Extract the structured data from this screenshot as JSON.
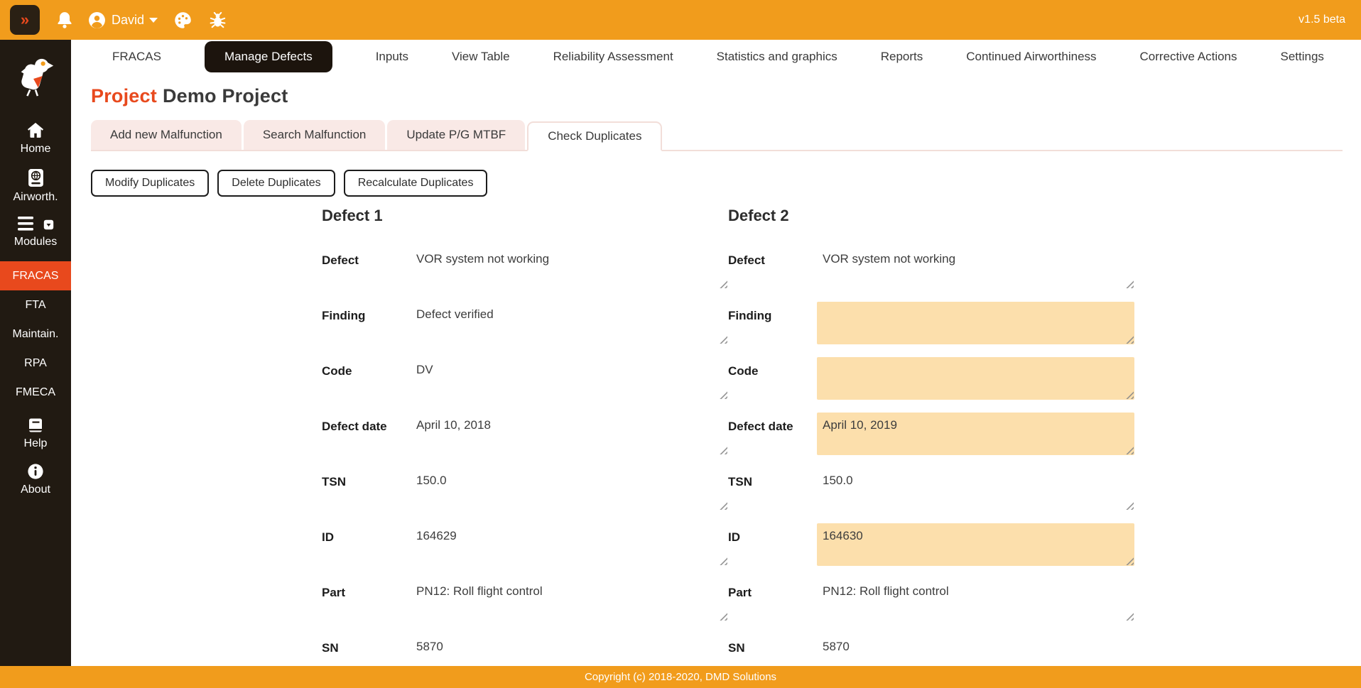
{
  "topbar": {
    "collapse_label": "»",
    "user_name": "David",
    "version": "v1.5 beta"
  },
  "sidebar": {
    "items": [
      {
        "label": "Home",
        "icon": "home-icon"
      },
      {
        "label": "Airworth.",
        "icon": "passport-icon"
      },
      {
        "label": "Modules",
        "icon": "menu-icon"
      },
      {
        "label": "FRACAS",
        "active": true
      },
      {
        "label": "FTA"
      },
      {
        "label": "Maintain."
      },
      {
        "label": "RPA"
      },
      {
        "label": "FMECA"
      },
      {
        "label": "Help",
        "icon": "book-icon"
      },
      {
        "label": "About",
        "icon": "info-icon"
      }
    ]
  },
  "nav": {
    "items": [
      {
        "label": "FRACAS"
      },
      {
        "label": "Manage Defects",
        "active": true
      },
      {
        "label": "Inputs"
      },
      {
        "label": "View Table"
      },
      {
        "label": "Reliability Assessment"
      },
      {
        "label": "Statistics and graphics"
      },
      {
        "label": "Reports"
      },
      {
        "label": "Continued Airworthiness"
      },
      {
        "label": "Corrective Actions"
      },
      {
        "label": "Settings"
      }
    ]
  },
  "page": {
    "title_label": "Project",
    "title_value": "Demo Project"
  },
  "subtabs": {
    "items": [
      {
        "label": "Add new Malfunction"
      },
      {
        "label": "Search Malfunction"
      },
      {
        "label": "Update P/G MTBF"
      },
      {
        "label": "Check Duplicates",
        "active": true
      }
    ]
  },
  "toolbar": {
    "modify_label": "Modify Duplicates",
    "delete_label": "Delete Duplicates",
    "recalculate_label": "Recalculate Duplicates"
  },
  "comparison": {
    "left": {
      "heading": "Defect 1",
      "fields": [
        {
          "label": "Defect",
          "value": "VOR system not working"
        },
        {
          "label": "Finding",
          "value": "Defect verified"
        },
        {
          "label": "Code",
          "value": "DV"
        },
        {
          "label": "Defect date",
          "value": "April 10, 2018"
        },
        {
          "label": "TSN",
          "value": "150.0"
        },
        {
          "label": "ID",
          "value": "164629"
        },
        {
          "label": "Part",
          "value": "PN12: Roll flight control"
        },
        {
          "label": "SN",
          "value": "5870"
        }
      ]
    },
    "right": {
      "heading": "Defect 2",
      "fields": [
        {
          "label": "Defect",
          "value": "VOR system not working"
        },
        {
          "label": "Finding",
          "value": "",
          "highlighted": true
        },
        {
          "label": "Code",
          "value": "",
          "highlighted": true
        },
        {
          "label": "Defect date",
          "value": "April 10, 2019",
          "highlighted": true
        },
        {
          "label": "TSN",
          "value": "150.0"
        },
        {
          "label": "ID",
          "value": "164630",
          "highlighted": true
        },
        {
          "label": "Part",
          "value": "PN12: Roll flight control"
        },
        {
          "label": "SN",
          "value": "5870"
        }
      ]
    }
  },
  "colors": {
    "topbar_orange": "#F19C1C",
    "accent_red": "#E8491D",
    "sidebar_dark": "#211A12",
    "highlight_field": "#FCDFAC",
    "tab_pink": "#F9E9E6"
  },
  "footer": {
    "copyright": "Copyright (c) 2018-2020, DMD Solutions"
  }
}
